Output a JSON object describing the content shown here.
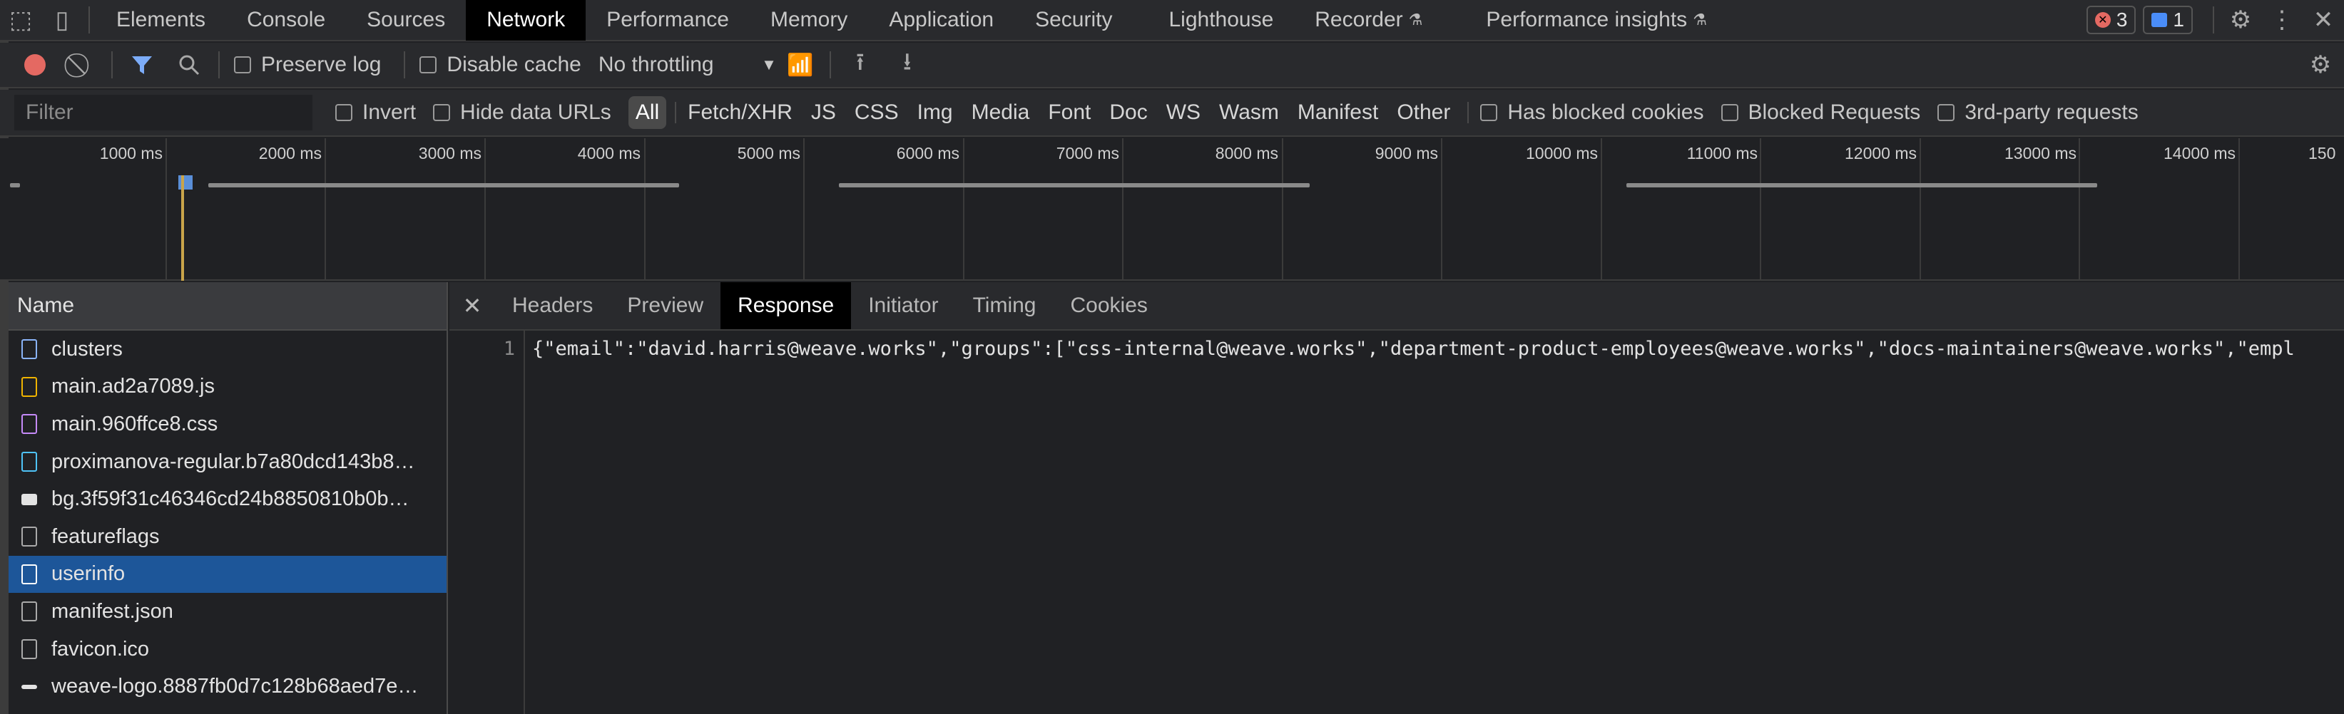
{
  "tabs": [
    "Elements",
    "Console",
    "Sources",
    "Network",
    "Performance",
    "Memory",
    "Application",
    "Security",
    "Lighthouse",
    "Recorder",
    "Performance insights"
  ],
  "active_tab": "Network",
  "badges": {
    "errors": "3",
    "messages": "1"
  },
  "toolbar": {
    "preserve_log": "Preserve log",
    "disable_cache": "Disable cache",
    "throttling": "No throttling"
  },
  "filterbar": {
    "placeholder": "Filter",
    "invert": "Invert",
    "hide_data_urls": "Hide data URLs",
    "types": [
      "All",
      "Fetch/XHR",
      "JS",
      "CSS",
      "Img",
      "Media",
      "Font",
      "Doc",
      "WS",
      "Wasm",
      "Manifest",
      "Other"
    ],
    "has_blocked_cookies": "Has blocked cookies",
    "blocked_requests": "Blocked Requests",
    "third_party": "3rd-party requests"
  },
  "timeline": {
    "ticks": [
      "1000 ms",
      "2000 ms",
      "3000 ms",
      "4000 ms",
      "5000 ms",
      "6000 ms",
      "7000 ms",
      "8000 ms",
      "9000 ms",
      "10000 ms",
      "11000 ms",
      "12000 ms",
      "13000 ms",
      "14000 ms",
      "150"
    ]
  },
  "requests": {
    "header": "Name",
    "items": [
      {
        "name": "clusters",
        "type": "doc",
        "color": "#8ab4f8"
      },
      {
        "name": "main.ad2a7089.js",
        "type": "script",
        "color": "#f0b400"
      },
      {
        "name": "main.960ffce8.css",
        "type": "stylesheet",
        "color": "#c58af9"
      },
      {
        "name": "proximanova-regular.b7a80dcd143b8…",
        "type": "font",
        "color": "#4fc3f7"
      },
      {
        "name": "bg.3f59f31c46346cd24b8850810b0b…",
        "type": "image",
        "color": "#e3e3e3"
      },
      {
        "name": "featureflags",
        "type": "fetch",
        "color": "#aaaaaa"
      },
      {
        "name": "userinfo",
        "type": "fetch",
        "color": "#ffffff"
      },
      {
        "name": "manifest.json",
        "type": "other",
        "color": "#aaaaaa"
      },
      {
        "name": "favicon.ico",
        "type": "other",
        "color": "#aaaaaa"
      },
      {
        "name": "weave-logo.8887fb0d7c128b68aed7e…",
        "type": "image",
        "color": "#e3e3e3"
      }
    ],
    "selected": "userinfo"
  },
  "detail_tabs": [
    "Headers",
    "Preview",
    "Response",
    "Initiator",
    "Timing",
    "Cookies"
  ],
  "active_detail_tab": "Response",
  "response": {
    "line_number": "1",
    "text": "{\"email\":\"david.harris@weave.works\",\"groups\":[\"css-internal@weave.works\",\"department-product-employees@weave.works\",\"docs-maintainers@weave.works\",\"empl"
  },
  "colors": {
    "accent": "#1d5699",
    "record": "#e46962",
    "filter_active": "#7cacf8"
  }
}
